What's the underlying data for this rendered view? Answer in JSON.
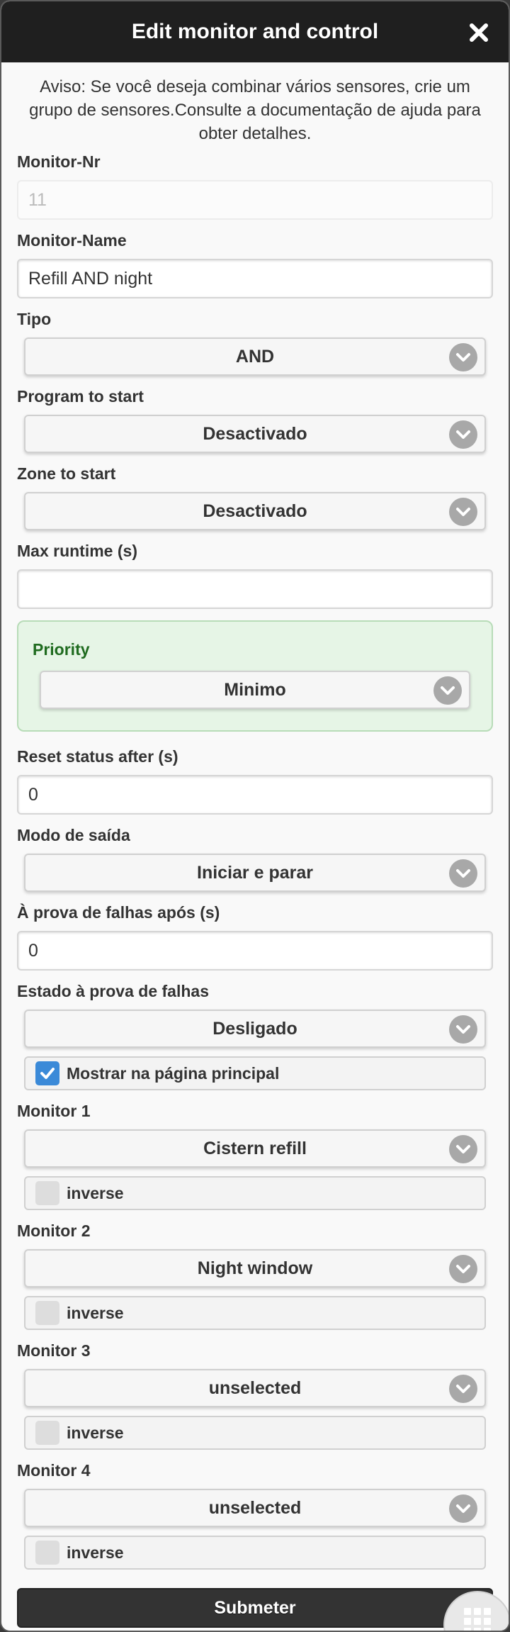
{
  "dialog": {
    "title": "Edit monitor and control",
    "notice": "Aviso: Se você deseja combinar vários sensores, crie um grupo de sensores.Consulte a documentação de ajuda para obter detalhes."
  },
  "fields": {
    "monitor_nr": {
      "label": "Monitor-Nr",
      "value": "11"
    },
    "monitor_name": {
      "label": "Monitor-Name",
      "value": "Refill AND night"
    },
    "tipo": {
      "label": "Tipo",
      "value": "AND"
    },
    "program": {
      "label": "Program to start",
      "value": "Desactivado"
    },
    "zone": {
      "label": "Zone to start",
      "value": "Desactivado"
    },
    "max_runtime": {
      "label": "Max runtime (s)",
      "value": ""
    },
    "priority": {
      "label": "Priority",
      "value": "Minimo"
    },
    "reset_status": {
      "label": "Reset status after (s)",
      "value": "0"
    },
    "output_mode": {
      "label": "Modo de saída",
      "value": "Iniciar e parar"
    },
    "failsafe_after": {
      "label": "À prova de falhas após (s)",
      "value": "0"
    },
    "failsafe_state": {
      "label": "Estado à prova de falhas",
      "value": "Desligado"
    },
    "show_main": {
      "label": "Mostrar na página principal",
      "checked": true
    }
  },
  "monitors": [
    {
      "label": "Monitor 1",
      "value": "Cistern refill",
      "inverse_label": "inverse",
      "inverse": false
    },
    {
      "label": "Monitor 2",
      "value": "Night window",
      "inverse_label": "inverse",
      "inverse": false
    },
    {
      "label": "Monitor 3",
      "value": "unselected",
      "inverse_label": "inverse",
      "inverse": false
    },
    {
      "label": "Monitor 4",
      "value": "unselected",
      "inverse_label": "inverse",
      "inverse": false
    }
  ],
  "submit_label": "Submeter",
  "colors": {
    "header": "#1f1f1f",
    "priority_bg": "#e6f5e6",
    "checkbox_on": "#3b8ad8",
    "submit": "#333333"
  },
  "icons": {
    "close": "close-icon",
    "chevron": "chevron-down-icon",
    "check": "check-icon",
    "menu": "grid-menu-icon"
  }
}
